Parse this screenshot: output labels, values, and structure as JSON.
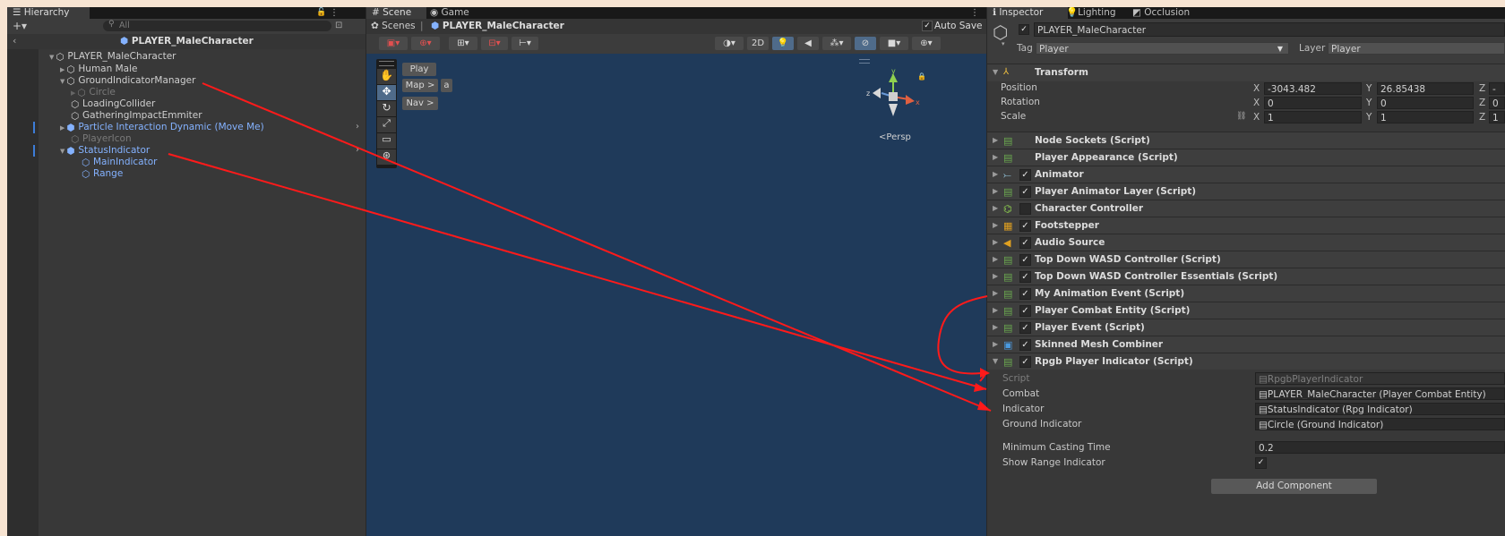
{
  "hierarchy": {
    "tab": "Hierarchy",
    "search_placeholder": "All",
    "breadcrumb": "PLAYER_MaleCharacter",
    "root": "PLAYER_MaleCharacter",
    "nodes": {
      "human_male": "Human Male",
      "ground_indicator_manager": "GroundIndicatorManager",
      "circle": "Circle",
      "loading_collider": "LoadingCollider",
      "gathering_impact": "GatheringImpactEmmiter",
      "particle_interaction": "Particle Interaction Dynamic (Move Me)",
      "player_icon": "PlayerIcon",
      "status_indicator": "StatusIndicator",
      "main_indicator": "MainIndicator",
      "range": "Range"
    }
  },
  "scene": {
    "tab_scene": "Scene",
    "tab_game": "Game",
    "breadcrumb_root": "Scenes",
    "breadcrumb_item": "PLAYER_MaleCharacter",
    "auto_save": "Auto Save",
    "btn_2d": "2D",
    "overlay": {
      "play": "Play",
      "map": "Map >",
      "a": "a",
      "nav": "Nav >"
    },
    "persp": "Persp",
    "gizmo": {
      "y": "y",
      "z": "z",
      "x": "x"
    }
  },
  "inspector": {
    "tabs": {
      "inspector": "Inspector",
      "lighting": "Lighting",
      "occlusion": "Occlusion"
    },
    "object_name": "PLAYER_MaleCharacter",
    "tag_label": "Tag",
    "tag_value": "Player",
    "layer_label": "Layer",
    "layer_value": "Player",
    "transform": {
      "title": "Transform",
      "position_label": "Position",
      "rotation_label": "Rotation",
      "scale_label": "Scale",
      "x": "X",
      "y": "Y",
      "z": "Z",
      "pos_x": "-3043.482",
      "pos_y": "26.85438",
      "pos_z": "-",
      "rot_x": "0",
      "rot_y": "0",
      "rot_z": "0",
      "scale_x": "1",
      "scale_y": "1",
      "scale_z": "1"
    },
    "components": {
      "node_sockets": "Node Sockets (Script)",
      "player_appearance": "Player Appearance (Script)",
      "animator": "Animator",
      "player_animator_layer": "Player Animator Layer (Script)",
      "character_controller": "Character Controller",
      "footstepper": "Footstepper",
      "audio_source": "Audio Source",
      "wasd_controller": "Top Down WASD Controller (Script)",
      "wasd_essentials": "Top Down WASD Controller Essentials (Script)",
      "my_animation_event": "My Animation Event (Script)",
      "player_combat_entity": "Player Combat Entity (Script)",
      "player_event": "Player Event (Script)",
      "skinned_mesh_combiner": "Skinned Mesh Combiner",
      "rpgb_player_indicator": "Rpgb Player Indicator (Script)"
    },
    "check": "✓",
    "rpgb": {
      "script_label": "Script",
      "script_value": "RpgbPlayerIndicator",
      "combat_label": "Combat",
      "combat_value": "PLAYER_MaleCharacter (Player Combat Entity)",
      "indicator_label": "Indicator",
      "indicator_value": "StatusIndicator (Rpg Indicator)",
      "ground_label": "Ground Indicator",
      "ground_value": "Circle (Ground Indicator)",
      "min_cast_label": "Minimum Casting Time",
      "min_cast_value": "0.2",
      "show_range_label": "Show Range Indicator"
    },
    "add_component": "Add Component"
  },
  "colors": {
    "accent_blue": "#84b2ff",
    "annotation_red": "#ff1a1a",
    "scene_bg": "#1f3a5a",
    "component_script_icon": "#6aa84f"
  }
}
